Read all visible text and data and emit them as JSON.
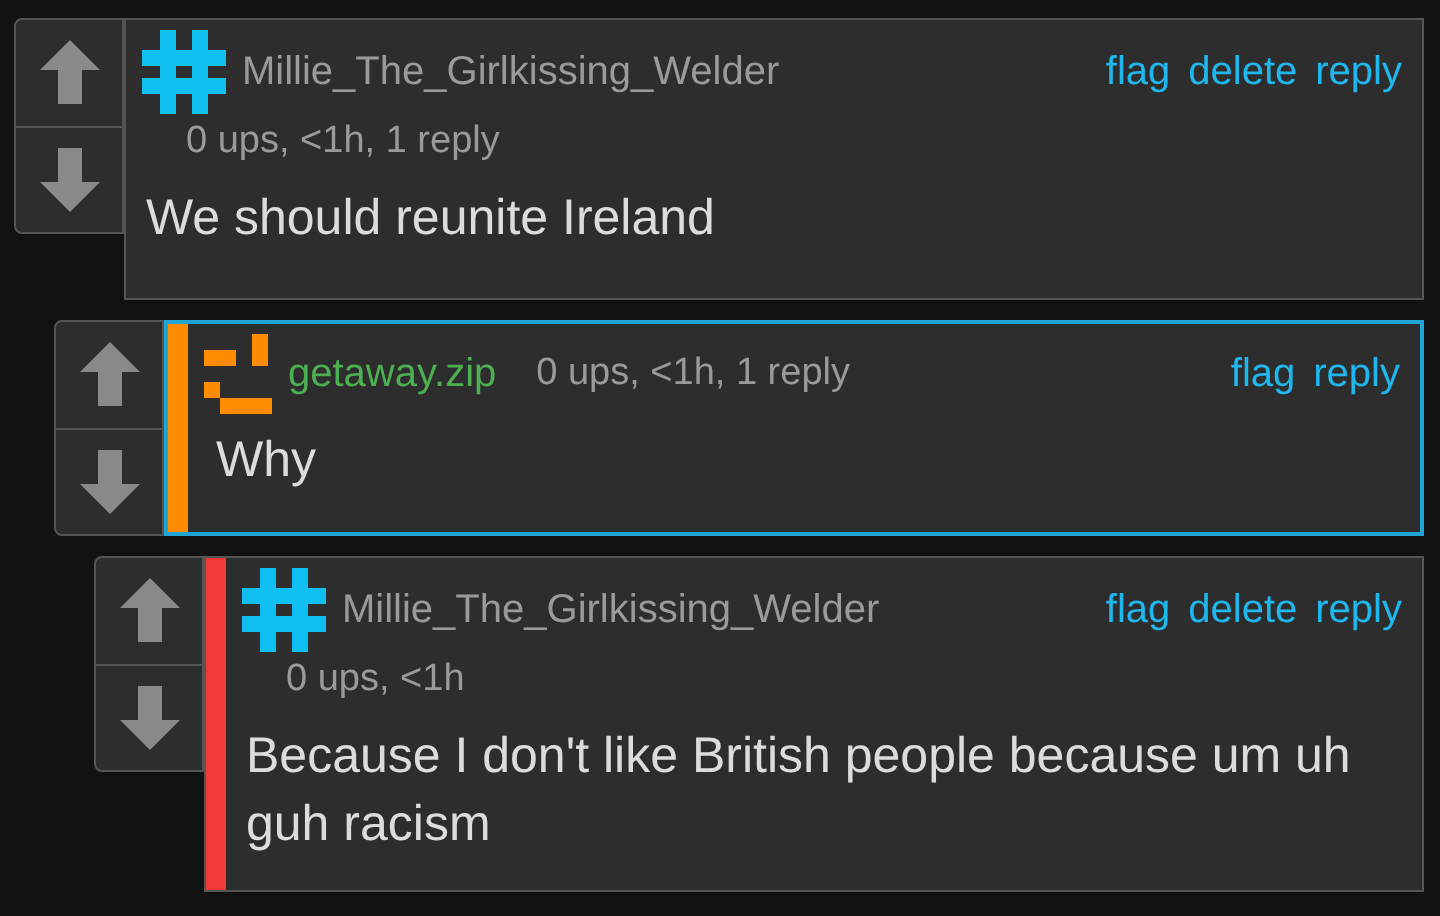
{
  "comments": [
    {
      "kind": "stacked",
      "highlighted": false,
      "avatar": {
        "kind": "hash"
      },
      "username": {
        "text": "Millie_The_Girlkissing_Welder",
        "color": "#9a9a9a"
      },
      "meta": "0 ups, <1h, 1 reply",
      "actions": [
        "flag",
        "delete",
        "reply"
      ],
      "text": "We should reunite Ireland"
    },
    {
      "kind": "inline",
      "highlighted": true,
      "accent_bar": {
        "color": "#ff8c00"
      },
      "avatar": {
        "kind": "pixel"
      },
      "username": {
        "text": "getaway.zip",
        "color": "#4caf50"
      },
      "meta": "0 ups, <1h, 1 reply",
      "actions": [
        "flag",
        "reply"
      ],
      "text": "Why"
    },
    {
      "kind": "stacked",
      "highlighted": false,
      "accent_bar": {
        "color": "#f23a3a"
      },
      "avatar": {
        "kind": "hash"
      },
      "username": {
        "text": "Millie_The_Girlkissing_Welder",
        "color": "#9a9a9a"
      },
      "meta": "0 ups, <1h",
      "actions": [
        "flag",
        "delete",
        "reply"
      ],
      "text": "Because I don't like British people because um uh guh racism"
    }
  ]
}
